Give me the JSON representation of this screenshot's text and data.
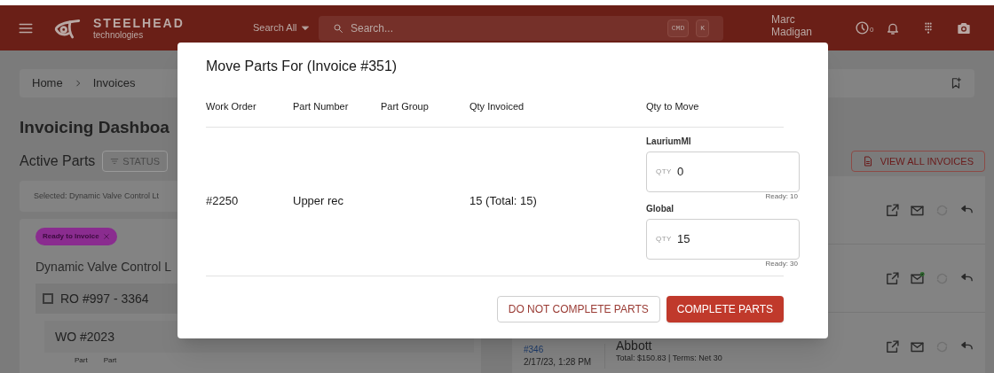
{
  "header": {
    "search_scope": "Search All",
    "search_placeholder": "Search...",
    "shortcut_keys": [
      "CMD",
      "K"
    ],
    "user_name": "Marc Madigan",
    "clock_count": "0",
    "logo_name": "STEELHEAD",
    "logo_tagline": "technologies"
  },
  "breadcrumb": [
    "Home",
    "Invoices"
  ],
  "page_title": "Invoicing Dashboa",
  "active_parts": {
    "title": "Active Parts",
    "filter_button": "STATUS",
    "selected_text": "Selected: Dynamic Valve Control Lt",
    "chip": "Ready to Invoice",
    "customer": "Dynamic Valve Control L",
    "ro_row": {
      "label": "RO #997 - 3364",
      "checked": false
    },
    "wo_label": "WO #2023",
    "column_labels": [
      "Part",
      "Part"
    ]
  },
  "view_all_button": "VIEW ALL INVOICES",
  "invoices": [
    {
      "email_sent": false
    },
    {
      "email_sent": true
    },
    {
      "number": "#346",
      "date": "2/17/23, 1:28 PM",
      "customer": "Abbott",
      "summary": "Total: $150.83 | Terms: Net 30",
      "email_sent": false
    }
  ],
  "dialog": {
    "title": "Move Parts For (Invoice #351)",
    "columns": [
      "Work Order",
      "Part Number",
      "Part Group",
      "Qty Invoiced",
      "Qty to Move"
    ],
    "rows": [
      {
        "work_order": "#2250",
        "part_number": "Upper rec",
        "qty_invoiced": "15 (Total: 15)",
        "locations": [
          {
            "name": "LauriumMI",
            "prefix": "QTY",
            "value": "0",
            "ready": "Ready: 10"
          },
          {
            "name": "Global",
            "prefix": "QTY",
            "value": "15",
            "ready": "Ready: 30"
          }
        ]
      }
    ],
    "buttons": [
      {
        "label": "DO NOT COMPLETE PARTS",
        "kind": "outlined"
      },
      {
        "label": "COMPLETE PARTS",
        "kind": "contained"
      }
    ]
  }
}
